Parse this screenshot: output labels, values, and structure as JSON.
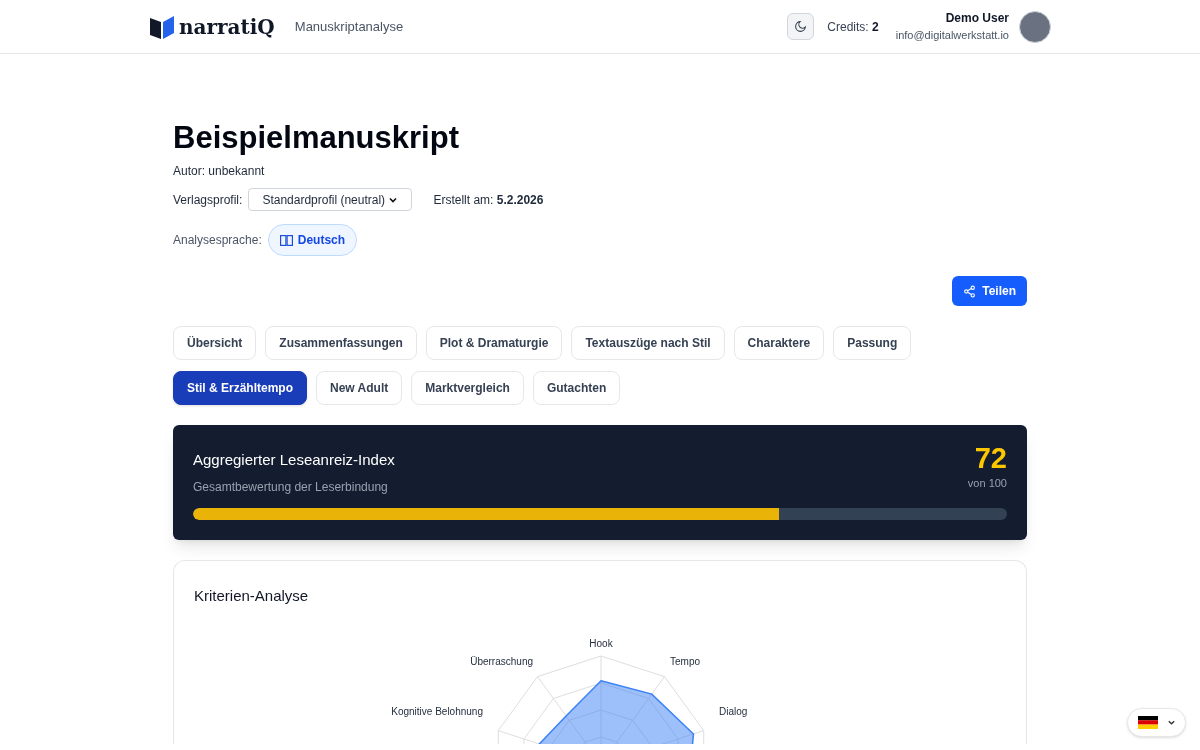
{
  "header": {
    "logo_text": "narratiQ",
    "section": "Manuskriptanalyse",
    "credits_label": "Credits:",
    "credits_value": "2",
    "user_name": "Demo User",
    "user_email": "info@digitalwerkstatt.io"
  },
  "manuscript": {
    "title": "Beispielmanuskript",
    "author": "Autor: unbekannt",
    "profile_label": "Verlagsprofil:",
    "profile_value": "Standardprofil (neutral)",
    "created_label": "Erstellt am:",
    "created_value": "5.2.2026",
    "language_label": "Analysesprache:",
    "language_value": "Deutsch"
  },
  "share_button": "Teilen",
  "tabs": [
    {
      "label": "Übersicht",
      "selected": false
    },
    {
      "label": "Zusammenfassungen",
      "selected": false
    },
    {
      "label": "Plot & Dramaturgie",
      "selected": false
    },
    {
      "label": "Textauszüge nach Stil",
      "selected": false
    },
    {
      "label": "Charaktere",
      "selected": false
    },
    {
      "label": "Passung",
      "selected": false
    },
    {
      "label": "Stil & Erzähltempo",
      "selected": true
    },
    {
      "label": "New Adult",
      "selected": false
    },
    {
      "label": "Marktvergleich",
      "selected": false
    },
    {
      "label": "Gutachten",
      "selected": false
    }
  ],
  "index_card": {
    "title": "Aggregierter Leseanreiz-Index",
    "subtitle": "Gesamtbewertung der Leserbindung",
    "score": "72",
    "score_suffix": "von 100",
    "level": 0.72
  },
  "criteria": {
    "title": "Kriterien-Analyse",
    "axis_labels": [
      "Hook",
      "Tempo",
      "Dialog",
      "Kognitive Belohnung",
      "Überraschung"
    ]
  }
}
